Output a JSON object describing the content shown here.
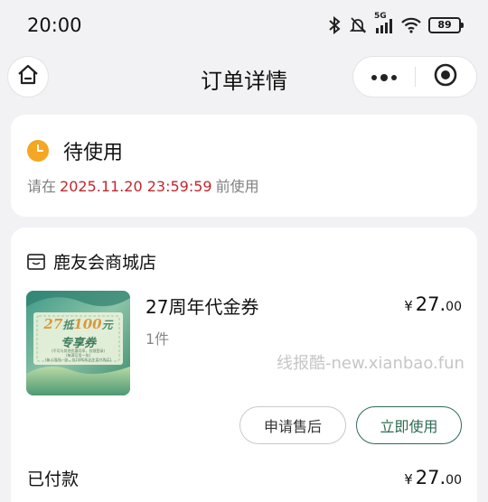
{
  "status_bar": {
    "time": "20:00",
    "battery": "89",
    "network": "5G"
  },
  "nav": {
    "title": "订单详情"
  },
  "order_status": {
    "label": "待使用",
    "deadline_prefix": "请在",
    "deadline": "2025.11.20 23:59:59",
    "deadline_suffix": "前使用"
  },
  "shop": {
    "name": "鹿友会商城店"
  },
  "product": {
    "title": "27周年代金券",
    "quantity": "1件",
    "price_symbol": "¥",
    "price_int": "27.",
    "price_dec": "00",
    "image": {
      "headline_num1": "27",
      "headline_mid": "抵",
      "headline_num2": "100",
      "headline_end": "元",
      "subtitle": "专享券",
      "fine1": "(不可与其他优惠同享，仅限登录)",
      "fine2": "(每满可用一张)",
      "fine3": "(每人限领一张，仅1990年出生用户购买)"
    }
  },
  "actions": {
    "after_sale": "申请售后",
    "use_now": "立即使用"
  },
  "payment": {
    "label": "已付款",
    "price_symbol": "¥",
    "price_int": "27.",
    "price_dec": "00"
  },
  "watermark": "线报酷-new.xianbao.fun",
  "colors": {
    "accent_green": "#2d6b52",
    "deadline_red": "#c0272d",
    "status_orange": "#f5a623"
  }
}
